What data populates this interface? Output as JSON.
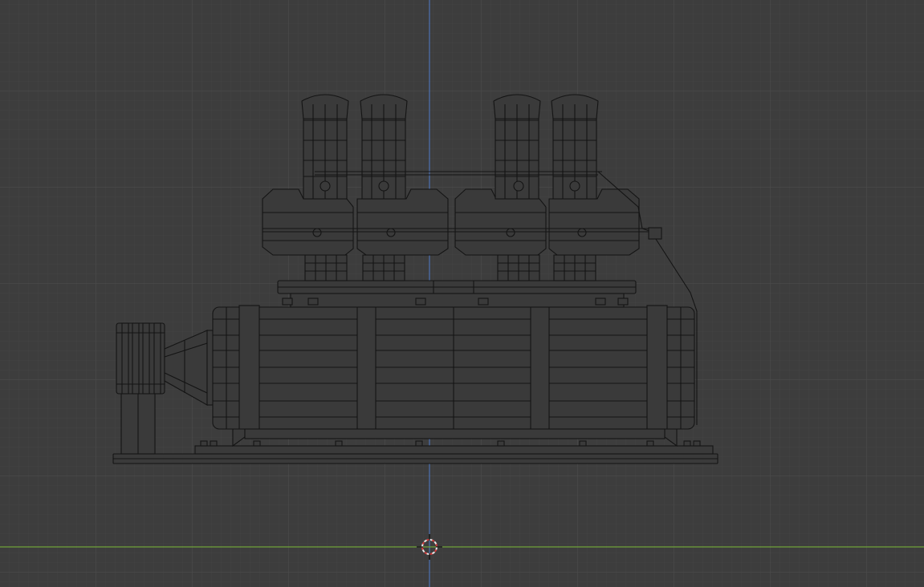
{
  "viewport": {
    "background_color": "#3d3d3d",
    "grid_minor_color": "#444444",
    "grid_major_color": "#4a4a4a",
    "z_axis_color": "#4f7cc9",
    "x_axis_color": "#6fa23a",
    "wireframe_color": "#141414",
    "model_fill_color": "#3a3a3a",
    "cursor_icon": "3d-cursor-icon",
    "cursor_colors": [
      "#e8e8e8",
      "#d23b3b"
    ]
  }
}
